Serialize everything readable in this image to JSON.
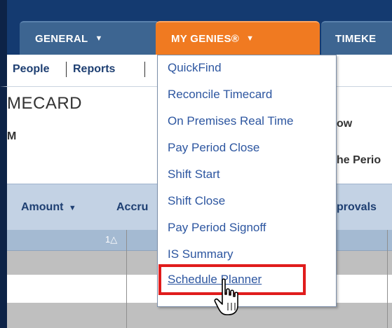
{
  "tabs": [
    {
      "label": "GENERAL",
      "arrow": "▼"
    },
    {
      "label": "MY GENIES®",
      "arrow": "▼"
    },
    {
      "label": "TIMEKE"
    }
  ],
  "subnav": {
    "people": "People",
    "reports": "Reports"
  },
  "page": {
    "title": "MECARD",
    "subtitle": "M",
    "right_a": "ow",
    "right_b": "he Perio"
  },
  "toolbar": {
    "amount": "Amount",
    "amount_arrow": "▼",
    "accruals": "Accru",
    "approvals": "provals"
  },
  "grid": {
    "sort_label": "1△"
  },
  "menu": {
    "items": [
      "QuickFind",
      "Reconcile Timecard",
      "On Premises Real Time",
      "Pay Period Close",
      "Shift Start",
      "Shift Close",
      "Pay Period Signoff",
      "IS Summary",
      "Schedule Planner"
    ]
  },
  "colors": {
    "active_tab": "#f07a21",
    "nav_dark": "#143a70",
    "menu_link": "#2d56a0",
    "highlight_border": "#e01c1c"
  },
  "icons": {
    "cursor": "hand-pointer-icon"
  }
}
